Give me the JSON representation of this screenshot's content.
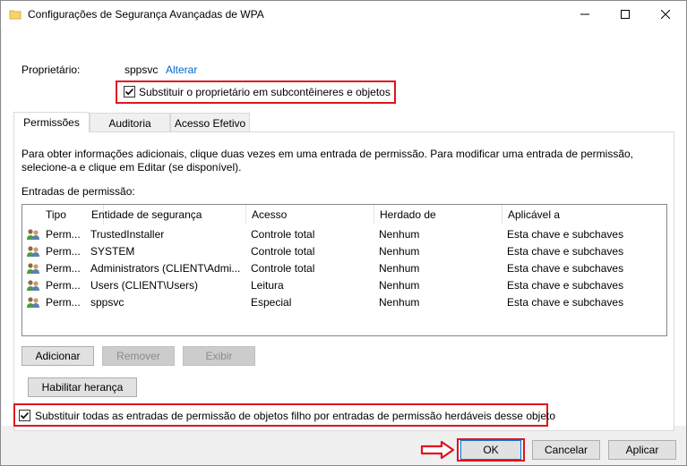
{
  "window": {
    "title": "Configurações de Segurança Avançadas de WPA"
  },
  "owner": {
    "label": "Proprietário:",
    "value": "sppsvc",
    "change_link": "Alterar",
    "replace_checkbox_label": "Substituir o proprietário em subcontêineres e objetos",
    "replace_checked": true
  },
  "tabs": [
    {
      "label": "Permissões",
      "active": true
    },
    {
      "label": "Auditoria",
      "active": false
    },
    {
      "label": "Acesso Efetivo",
      "active": false
    }
  ],
  "permissions": {
    "info_line1": "Para obter informações adicionais, clique duas vezes em uma entrada de permissão. Para modificar uma entrada de permissão,",
    "info_line2": "selecione-a e clique em Editar (se disponível).",
    "entries_label": "Entradas de permissão:",
    "columns": [
      "Tipo",
      "Entidade de segurança",
      "Acesso",
      "Herdado de",
      "Aplicável a"
    ],
    "rows": [
      {
        "type": "Perm...",
        "principal": "TrustedInstaller",
        "access": "Controle total",
        "inherited": "Nenhum",
        "applies": "Esta chave e subchaves"
      },
      {
        "type": "Perm...",
        "principal": "SYSTEM",
        "access": "Controle total",
        "inherited": "Nenhum",
        "applies": "Esta chave e subchaves"
      },
      {
        "type": "Perm...",
        "principal": "Administrators (CLIENT\\Admi...",
        "access": "Controle total",
        "inherited": "Nenhum",
        "applies": "Esta chave e subchaves"
      },
      {
        "type": "Perm...",
        "principal": "Users (CLIENT\\Users)",
        "access": "Leitura",
        "inherited": "Nenhum",
        "applies": "Esta chave e subchaves"
      },
      {
        "type": "Perm...",
        "principal": "sppsvc",
        "access": "Especial",
        "inherited": "Nenhum",
        "applies": "Esta chave e subchaves"
      }
    ],
    "add_button": "Adicionar",
    "remove_button": "Remover",
    "view_button": "Exibir",
    "enable_inheritance_button": "Habilitar herança",
    "replace_children_label": "Substituir todas as entradas de permissão de objetos filho por entradas de permissão herdáveis desse objeto",
    "replace_children_checked": true
  },
  "footer": {
    "ok": "OK",
    "cancel": "Cancelar",
    "apply": "Aplicar"
  },
  "colors": {
    "highlight": "#e0141e",
    "link": "#0066cc"
  }
}
